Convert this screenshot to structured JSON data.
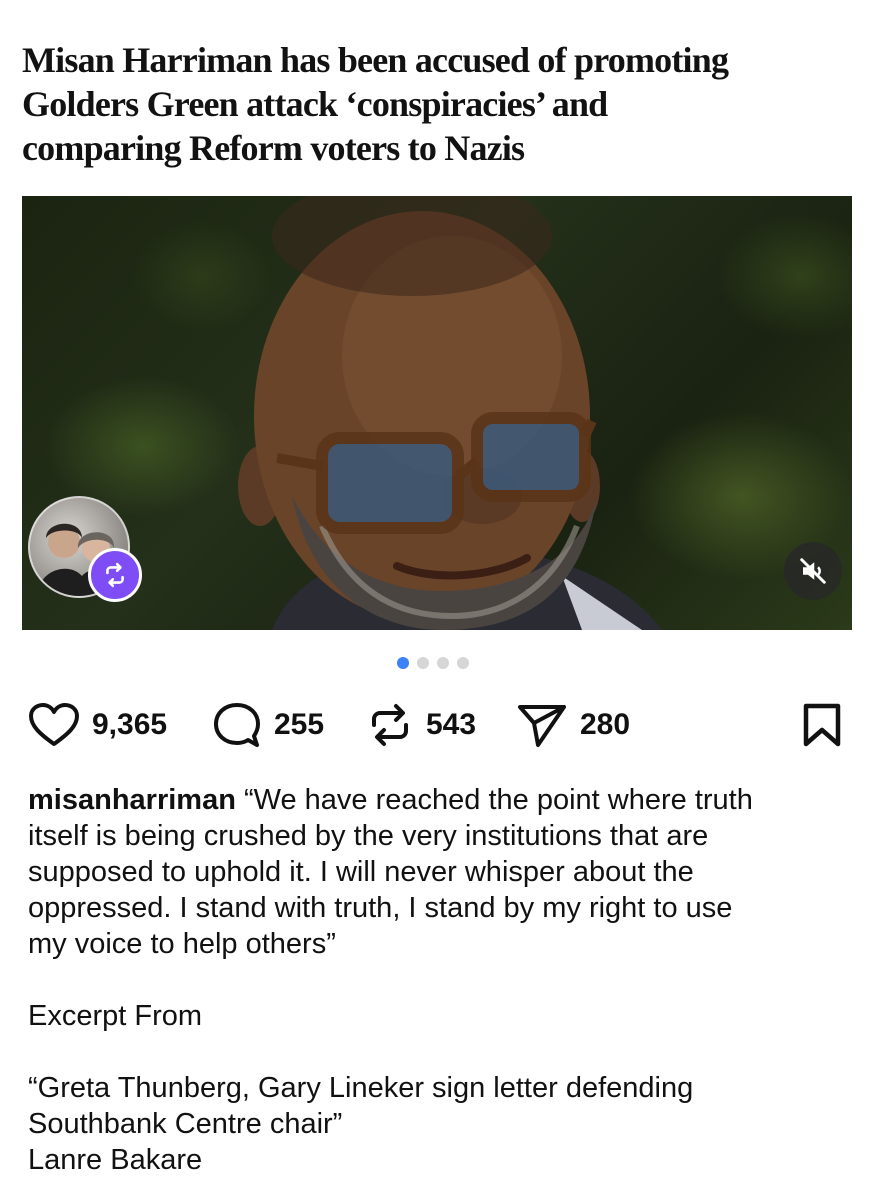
{
  "headline": {
    "lines": [
      "Misan Harriman has been accused of promoting",
      "Golders Green attack ‘conspiracies’ and",
      "comparing Reform voters to Nazis"
    ]
  },
  "media": {
    "carousel_count": 4,
    "carousel_active_index": 0
  },
  "actions": {
    "likes": "9,365",
    "comments": "255",
    "reposts": "543",
    "shares": "280"
  },
  "caption": {
    "username": "misanharriman",
    "first_line_rest": "“We have reached the point where truth",
    "lines": [
      "itself is being crushed by the very institutions that are",
      "supposed to uphold it. I will never whisper about the",
      "oppressed. I stand with truth, I stand by my right to use",
      "my voice to help others”"
    ],
    "excerpt_label": "Excerpt From",
    "source_lines": [
      "“Greta Thunberg, Gary Lineker sign letter defending",
      "Southbank Centre chair”"
    ],
    "author": "Lanre Bakare"
  },
  "colors": {
    "accent_blue": "#3b82f6",
    "repost_badge": "#7e4df5",
    "headline_text": "#121212"
  },
  "icons": [
    "repost-icon",
    "speaker-muted-icon",
    "heart-icon",
    "comment-icon",
    "share-icon",
    "bookmark-icon"
  ]
}
